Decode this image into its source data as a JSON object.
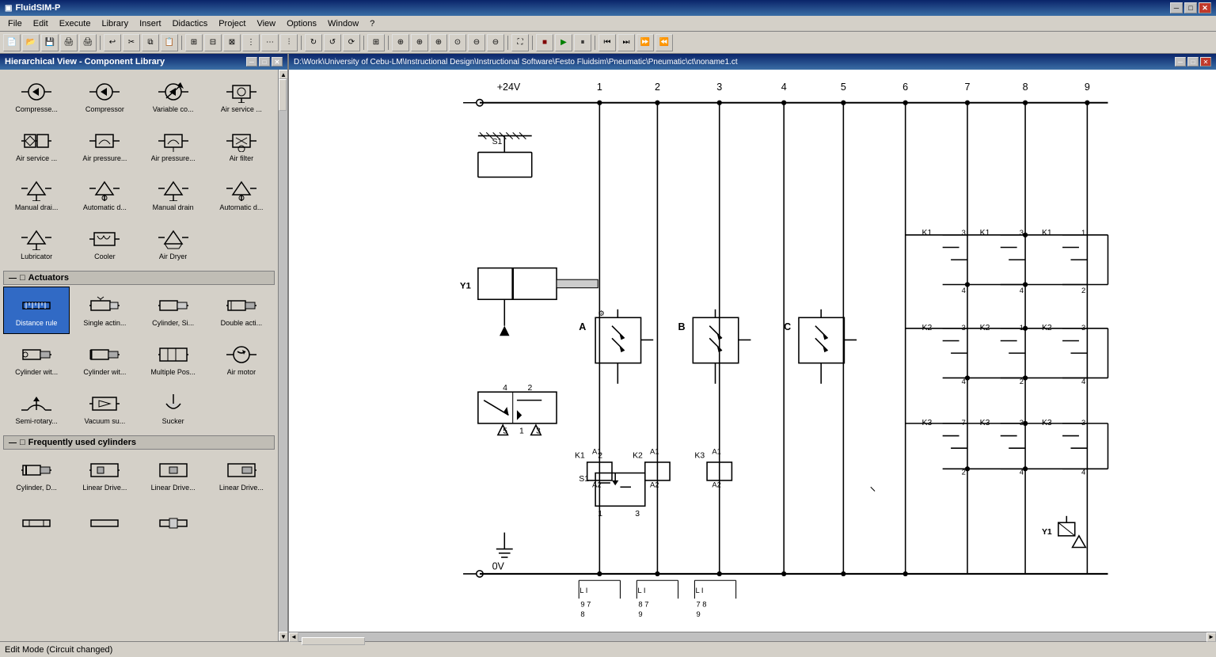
{
  "app": {
    "title": "FluidSIM-P",
    "icon": "fluidsim-icon"
  },
  "title_bar": {
    "label": "FluidSIM-P",
    "buttons": [
      "minimize",
      "maximize",
      "close"
    ]
  },
  "menu_bar": {
    "items": [
      "File",
      "Edit",
      "Execute",
      "Library",
      "Insert",
      "Didactics",
      "Project",
      "View",
      "Options",
      "Window",
      "?"
    ]
  },
  "library_panel": {
    "title": "Hierarchical View - Component Library",
    "sections": [
      {
        "name": "air-treatment",
        "components": [
          {
            "id": "compressor1",
            "label": "Compresse..."
          },
          {
            "id": "compressor2",
            "label": "Compressor"
          },
          {
            "id": "variable-co",
            "label": "Variable co..."
          },
          {
            "id": "air-service1",
            "label": "Air service ..."
          },
          {
            "id": "air-service2",
            "label": "Air service ..."
          },
          {
            "id": "air-pressure1",
            "label": "Air pressure..."
          },
          {
            "id": "air-pressure2",
            "label": "Air pressure..."
          },
          {
            "id": "air-filter",
            "label": "Air filter"
          },
          {
            "id": "manual-drain1",
            "label": "Manual drai..."
          },
          {
            "id": "auto-drain1",
            "label": "Automatic d..."
          },
          {
            "id": "manual-drain2",
            "label": "Manual drain"
          },
          {
            "id": "auto-drain2",
            "label": "Automatic d..."
          },
          {
            "id": "lubricator",
            "label": "Lubricator"
          },
          {
            "id": "cooler",
            "label": "Cooler"
          },
          {
            "id": "air-dryer",
            "label": "Air Dryer"
          }
        ]
      },
      {
        "name": "actuators",
        "label": "Actuators",
        "components": [
          {
            "id": "distance-rule",
            "label": "Distance rule",
            "selected": true
          },
          {
            "id": "single-act",
            "label": "Single actin..."
          },
          {
            "id": "cylinder-si",
            "label": "Cylinder, Si..."
          },
          {
            "id": "double-act",
            "label": "Double acti..."
          },
          {
            "id": "cylinder-wit1",
            "label": "Cylinder wit..."
          },
          {
            "id": "cylinder-wit2",
            "label": "Cylinder wit..."
          },
          {
            "id": "multiple-pos",
            "label": "Multiple Pos..."
          },
          {
            "id": "air-motor",
            "label": "Air motor"
          },
          {
            "id": "semi-rotary",
            "label": "Semi-rotary..."
          },
          {
            "id": "vacuum-su",
            "label": "Vacuum su..."
          },
          {
            "id": "sucker",
            "label": "Sucker"
          }
        ]
      },
      {
        "name": "frequently-used-cylinders",
        "label": "Frequently used cylinders",
        "components": [
          {
            "id": "cylinder-d",
            "label": "Cylinder, D..."
          },
          {
            "id": "linear-drive1",
            "label": "Linear Drive..."
          },
          {
            "id": "linear-drive2",
            "label": "Linear Drive..."
          },
          {
            "id": "linear-drive3",
            "label": "Linear Drive..."
          },
          {
            "id": "more1",
            "label": ""
          },
          {
            "id": "more2",
            "label": ""
          },
          {
            "id": "more3",
            "label": ""
          }
        ]
      }
    ]
  },
  "diagram_panel": {
    "title": "D:\\Work\\University of Cebu-LM\\Instructional Design\\Instructional Software\\Festo Fluidsim\\Pneumatic\\Pneumatic\\ct\\noname1.ct",
    "circuit": {
      "voltage_pos": "+24V",
      "voltage_neg": "0V",
      "columns": [
        "1",
        "2",
        "3",
        "4",
        "5",
        "6",
        "7",
        "8",
        "9"
      ],
      "components": {
        "S1_top": "S1",
        "S1_bottom": "S1",
        "Y1_left": "Y1",
        "Y1_right": "Y1",
        "A_label": "A",
        "B_label": "B",
        "C_label": "C",
        "K1_label": "K1",
        "K2_label": "K2",
        "K3_label": "K3",
        "A1_K1": "A1",
        "A2_K1": "A2",
        "A1_K2": "A1",
        "A2_K2": "A2",
        "A1_K3": "A1",
        "A2_K3": "A2",
        "K1_contacts_col7": "K1",
        "K1_contacts_col8": "K1",
        "K1_contacts_col9": "K1",
        "K2_contacts_col7": "K2",
        "K2_contacts_col8": "K2",
        "K2_contacts_col9": "K2",
        "K3_contacts_col7": "K3",
        "K3_contacts_col8": "K3",
        "K3_contacts_col9": "K3"
      }
    }
  },
  "status_bar": {
    "text": "Edit Mode (Circuit changed)"
  },
  "toolbar": {
    "buttons": [
      "new",
      "open",
      "save",
      "print-preview",
      "print",
      "undo",
      "cut",
      "copy",
      "paste",
      "align-left",
      "align-center",
      "align-right",
      "align-dist1",
      "align-dist2",
      "align-dist3",
      "rotation1",
      "rotation2",
      "rotation3",
      "table",
      "zoom-in-1",
      "zoom-in-2",
      "zoom-in-3",
      "zoom-custom",
      "zoom-out-1",
      "zoom-out-2",
      "fit",
      "stop",
      "play",
      "pause",
      "step-back",
      "step-forward",
      "fast-forward",
      "fast-back"
    ]
  }
}
